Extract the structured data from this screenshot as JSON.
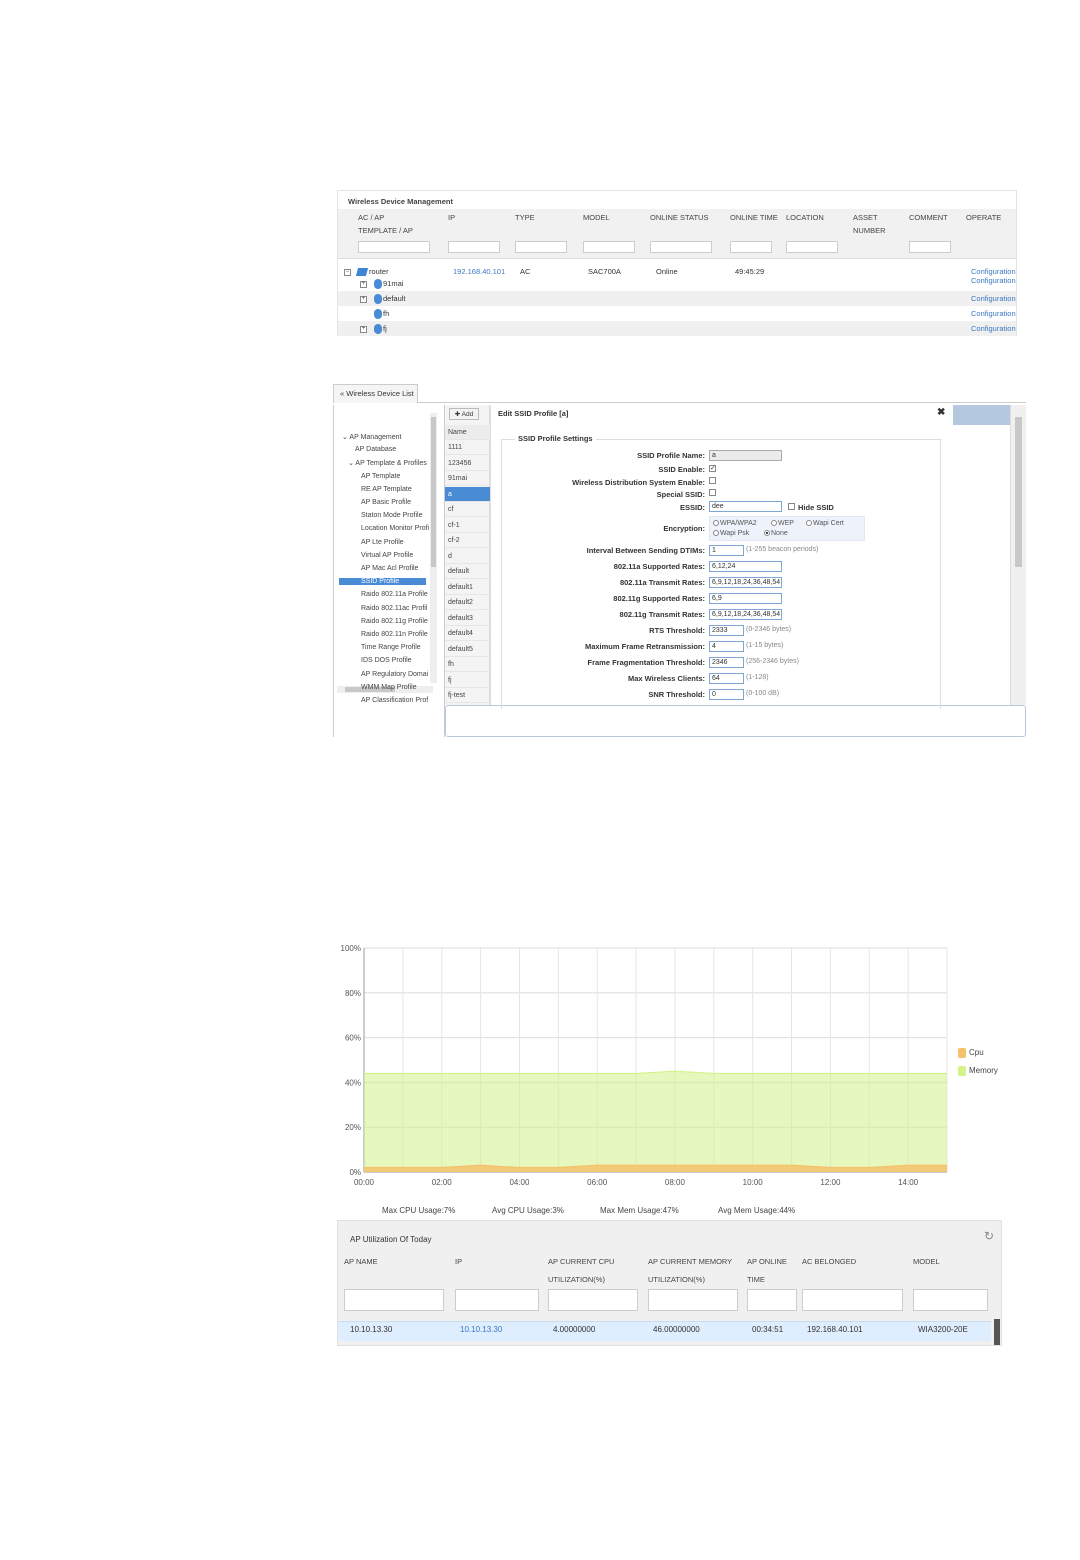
{
  "wdm": {
    "title": "Wireless Device Management",
    "columns": {
      "ac_ap_1": "AC / AP",
      "ac_ap_2": "TEMPLATE / AP",
      "ip": "IP",
      "type": "TYPE",
      "model": "MODEL",
      "online_status": "ONLINE STATUS",
      "online_time": "ONLINE TIME",
      "location": "LOCATION",
      "asset_1": "ASSET",
      "asset_2": "NUMBER",
      "comment": "COMMENT",
      "operate": "OPERATE"
    },
    "rows": [
      {
        "name": "router",
        "ip": "192.168.40.101",
        "type": "AC",
        "model": "SAC700A",
        "status": "Online",
        "time": "49:45:29",
        "op": "Configuration"
      },
      {
        "name": "91mai",
        "op": "Configuration"
      },
      {
        "name": "default",
        "op": "Configuration"
      },
      {
        "name": "fh",
        "op": "Configuration"
      },
      {
        "name": "fj",
        "op": "Configuration"
      }
    ]
  },
  "editor": {
    "tab_label": "« Wireless Device List",
    "add_label": "✚ Add",
    "name_header": "Name",
    "nav": [
      "⌄ AP Management",
      "AP Database",
      "⌄ AP Template & Profiles",
      "AP Template",
      "RE AP Template",
      "AP Basic Profile",
      "Staton Mode Profile",
      "Location Monitor Profi",
      "AP Lte Profile",
      "Virtual AP Profile",
      "AP Mac Acl Profile",
      "SSID Profile",
      "Raido 802.11a Profile",
      "Raido 802.11ac Profil",
      "Raido 802.11g Profile",
      "Raido 802.11n Profile",
      "Time Range Profile",
      "IDS DOS Profile",
      "AP Regulatory Domai",
      "WMM Map Profile",
      "AP Classification Prof"
    ],
    "names": [
      "1111",
      "123456",
      "91mai",
      "a",
      "cf",
      "cf-1",
      "cf-2",
      "d",
      "default",
      "default1",
      "default2",
      "default3",
      "default4",
      "default5",
      "fh",
      "fj",
      "fj-test"
    ],
    "dialog_title": "Edit SSID Profile [a]",
    "close": "✖",
    "section": "SSID Profile Settings",
    "fields": {
      "ssid_profile_name": {
        "label": "SSID Profile Name:",
        "value": "a"
      },
      "ssid_enable": {
        "label": "SSID Enable:",
        "check": "✓"
      },
      "wds_enable": {
        "label": "Wireless Distribution System Enable:"
      },
      "special_ssid": {
        "label": "Special SSID:"
      },
      "essid": {
        "label": "ESSID:",
        "value": "dee",
        "hide_label": "Hide SSID"
      },
      "encryption": {
        "label": "Encryption:",
        "opt1": "WPA/WPA2",
        "opt2": "WEP",
        "opt3": "Wapi Cert",
        "opt4": "Wapi Psk",
        "opt5": "None"
      },
      "dtim": {
        "label": "Interval Between Sending DTIMs:",
        "value": "1",
        "hint": "(1-255 beacon periods)"
      },
      "a_supported": {
        "label": "802.11a Supported Rates:",
        "value": "6,12,24"
      },
      "a_transmit": {
        "label": "802.11a Transmit Rates:",
        "value": "6,9,12,18,24,36,48,54"
      },
      "g_supported": {
        "label": "802.11g Supported Rates:",
        "value": "6,9"
      },
      "g_transmit": {
        "label": "802.11g Transmit Rates:",
        "value": "6,9,12,18,24,36,48,54"
      },
      "rts": {
        "label": "RTS Threshold:",
        "value": "2333",
        "hint": "(0-2346 bytes)"
      },
      "retrans": {
        "label": "Maximum Frame Retransmission:",
        "value": "4",
        "hint": "(1-15 bytes)"
      },
      "frag": {
        "label": "Frame Fragmentation Threshold:",
        "value": "2346",
        "hint": "(256-2346 bytes)"
      },
      "clients": {
        "label": "Max Wireless Clients:",
        "value": "64",
        "hint": "(1-128)"
      },
      "snr": {
        "label": "SNR Threshold:",
        "value": "0",
        "hint": "(0-100 dB)"
      }
    }
  },
  "chart_data": {
    "type": "area",
    "y_ticks": [
      "100%",
      "80%",
      "60%",
      "40%",
      "20%",
      "0%"
    ],
    "x_ticks": [
      "00:00",
      "02:00",
      "04:00",
      "06:00",
      "08:00",
      "10:00",
      "12:00",
      "14:00"
    ],
    "ylim": [
      0,
      100
    ],
    "xlim": [
      0,
      15
    ],
    "grid": true,
    "legend_position": "right",
    "x": [
      0,
      1,
      2,
      3,
      4,
      5,
      6,
      7,
      8,
      9,
      10,
      11,
      12,
      13,
      14,
      15
    ],
    "series": [
      {
        "name": "Cpu",
        "color": "#f5c26b",
        "values": [
          2,
          2,
          2,
          3,
          2,
          2,
          3,
          3,
          3,
          3,
          3,
          3,
          2,
          2,
          3,
          3
        ]
      },
      {
        "name": "Memory",
        "color": "#d4f28a",
        "values": [
          44,
          44,
          44,
          44,
          44,
          44,
          44,
          44,
          45,
          44,
          44,
          44,
          44,
          44,
          44,
          44
        ]
      }
    ]
  },
  "stats": {
    "max_cpu": "Max CPU Usage:7%",
    "avg_cpu": "Avg CPU Usage:3%",
    "max_mem": "Max Mem Usage:47%",
    "avg_mem": "Avg Mem Usage:44%"
  },
  "apu": {
    "title": "AP Utilization Of Today",
    "refresh_icon": "↻",
    "columns": {
      "ap_name": "AP NAME",
      "ip": "IP",
      "cpu_1": "AP CURRENT CPU",
      "cpu_2": "UTILIZATION(%)",
      "mem_1": "AP CURRENT MEMORY",
      "mem_2": "UTILIZATION(%)",
      "online_1": "AP ONLINE",
      "online_2": "TIME",
      "ac": "AC BELONGED",
      "model": "MODEL"
    },
    "row": {
      "ap_name": "10.10.13.30",
      "ip": "10.10.13.30",
      "cpu": "4.00000000",
      "mem": "46.00000000",
      "online": "00:34:51",
      "ac": "192.168.40.101",
      "model": "WIA3200-20E"
    }
  }
}
